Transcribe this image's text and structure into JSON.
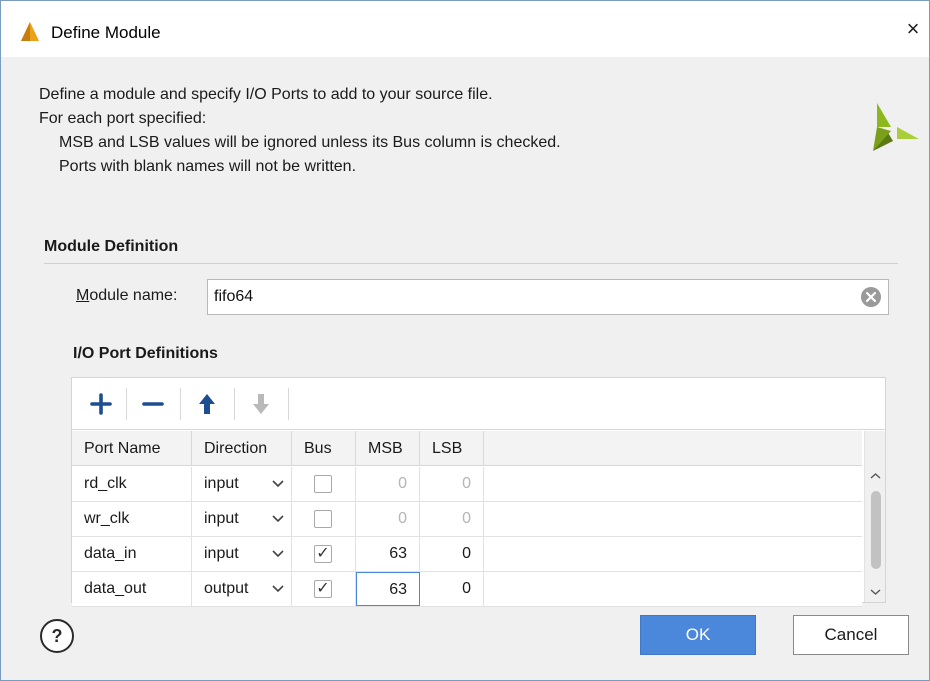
{
  "window": {
    "title": "Define Module",
    "close_glyph": "×"
  },
  "description": {
    "line1": "Define a module and specify I/O Ports to add to your source file.",
    "line2": "For each port specified:",
    "line3": "MSB and LSB values will be ignored unless its Bus column is checked.",
    "line4": "Ports with blank names will not be written."
  },
  "module_definition": {
    "section_title": "Module Definition",
    "name_label_mnemonic": "M",
    "name_label_rest": "odule name:",
    "name_value": "fifo64"
  },
  "io_ports": {
    "section_title": "I/O Port Definitions",
    "toolbar": [
      "add-icon",
      "remove-icon",
      "move-up-icon",
      "move-down-icon"
    ],
    "columns": [
      "Port Name",
      "Direction",
      "Bus",
      "MSB",
      "LSB"
    ],
    "rows": [
      {
        "name": "rd_clk",
        "direction": "input",
        "bus": false,
        "msb": "0",
        "lsb": "0"
      },
      {
        "name": "wr_clk",
        "direction": "input",
        "bus": false,
        "msb": "0",
        "lsb": "0"
      },
      {
        "name": "data_in",
        "direction": "input",
        "bus": true,
        "msb": "63",
        "lsb": "0"
      },
      {
        "name": "data_out",
        "direction": "output",
        "bus": true,
        "msb": "63",
        "lsb": "0"
      }
    ],
    "check_glyph": "✓"
  },
  "footer": {
    "help_label": "?",
    "ok_label": "OK",
    "cancel_label": "Cancel"
  },
  "colors": {
    "accent": "#4b87da",
    "logo_green": "#8cb81d",
    "logo_dark": "#5b7a14"
  }
}
